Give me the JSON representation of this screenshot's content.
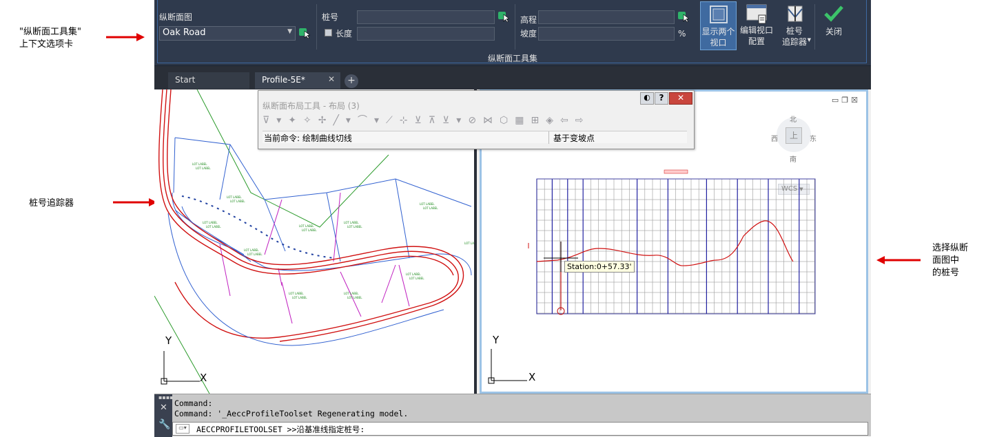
{
  "annotations": {
    "contextual_tab": "\"纵断面工具集\"\n上下文选项卡",
    "station_tracker": "桩号追踪器",
    "select_station": "选择纵断\n面图中\n的桩号"
  },
  "ribbon": {
    "profile_view_label": "纵断面图",
    "profile_view_value": "Oak Road",
    "station_label": "桩号",
    "length_label": "长度",
    "elevation_label": "高程",
    "grade_label": "坡度",
    "grade_unit": "%",
    "show_two_viewports": "显示两个\n视口",
    "edit_viewport_config": "编辑视口\n配置",
    "station_tracker": "桩号\n追踪器",
    "close": "关闭",
    "panel_title": "纵断面工具集"
  },
  "tabs": {
    "items": [
      {
        "label": "Start"
      },
      {
        "label": "Profile-5E*"
      }
    ],
    "add": "+"
  },
  "layout_toolbar": {
    "title": "纵断面布局工具 - 布局 (3)",
    "current_command": "当前命令: 绘制曲线切线",
    "mode": "基于变坡点"
  },
  "viewcube": {
    "north": "北",
    "south": "南",
    "east": "东",
    "west": "西",
    "top": "上",
    "wcs": "WCS"
  },
  "profile": {
    "tooltip": "Station:0+57.33'"
  },
  "axes": {
    "x": "X",
    "y": "Y"
  },
  "command": {
    "line1": "Command:",
    "line2": "Command: '_AeccProfileToolset Regenerating model.",
    "prompt": "AECCPROFILETOOLSET >>沿基准线指定桩号:"
  },
  "colors": {
    "ribbon_bg": "#2f3a4d",
    "active_button": "#3f6aa0",
    "viewport_border": "#9cc3e6",
    "annotation_arrow": "#e00000"
  }
}
